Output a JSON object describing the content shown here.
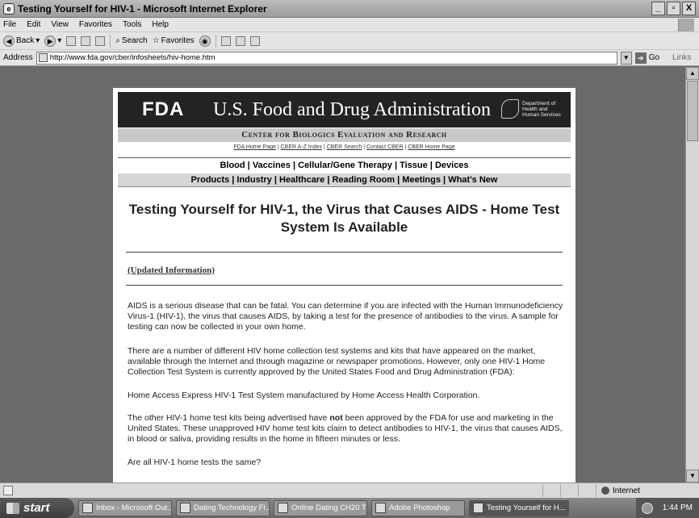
{
  "window": {
    "title": "Testing Yourself for HIV-1 - Microsoft Internet Explorer",
    "controls": [
      "_",
      "▫",
      "X"
    ]
  },
  "menubar": {
    "items": [
      "File",
      "Edit",
      "View",
      "Favorites",
      "Tools",
      "Help"
    ]
  },
  "toolbar": {
    "back_label": "Back",
    "search_label": "Search",
    "favorites_label": "Favorites"
  },
  "addressbar": {
    "label": "Address",
    "url": "http://www.fda.gov/cber/infosheets/hiv-home.htm",
    "go_label": "Go",
    "links_label": "Links"
  },
  "page": {
    "banner": {
      "logo": "FDA",
      "agency_name": "U.S. Food and Drug Administration",
      "hhs_text": "Department of Health and Human Services"
    },
    "center_name": "Center for Biologics Evaluation and Research",
    "util_links": [
      "FDA Home Page",
      "CBER A-Z Index",
      "CBER Search",
      "Contact CBER",
      "CBER Home Page"
    ],
    "nav_primary": [
      "Blood",
      "Vaccines",
      "Cellular/Gene Therapy",
      "Tissue",
      "Devices"
    ],
    "nav_secondary": [
      "Products",
      "Industry",
      "Healthcare",
      "Reading Room",
      "Meetings",
      "What's New"
    ],
    "headline": "Testing Yourself for HIV-1, the Virus that Causes AIDS - Home Test System Is Available",
    "updated_link": "(Updated Information)",
    "paragraphs": {
      "p1": "AIDS is a serious disease that can be fatal. You can determine if you are infected with the Human Immunodeficiency Virus-1 (HIV-1), the virus that causes AIDS, by taking a test for the presence of antibodies to the virus. A sample for testing can now be collected in your own home.",
      "p2": "There are a number of different HIV home collection test systems and kits that have appeared on the market, available through the Internet and through magazine or newspaper promotions. However, only one HIV-1 Home Collection Test System is currently approved by the United States Food and Drug Administration (FDA):",
      "p3": "Home Access Express HIV-1 Test System manufactured by Home Access Health Corporation.",
      "p4_before": "The other HIV-1 home test kits being advertised have ",
      "p4_bold": "not",
      "p4_after": " been approved by the FDA for use and marketing in the United States. These unapproved HIV home test kits claim to detect antibodies to HIV-1, the virus that causes AIDS, in blood or saliva, providing results in the home in fifteen minutes or less.",
      "p5": "Are all HIV-1 home tests the same?"
    }
  },
  "statusbar": {
    "zone_label": "Internet"
  },
  "taskbar": {
    "start_label": "start",
    "tasks": [
      {
        "label": "Inbox - Microsoft Out..."
      },
      {
        "label": "Dating Technology Fi..."
      },
      {
        "label": "Online Dating CH20 T..."
      },
      {
        "label": "Adobe Photoshop"
      },
      {
        "label": "Testing Yourself for H..."
      }
    ],
    "clock": "1:44 PM"
  }
}
